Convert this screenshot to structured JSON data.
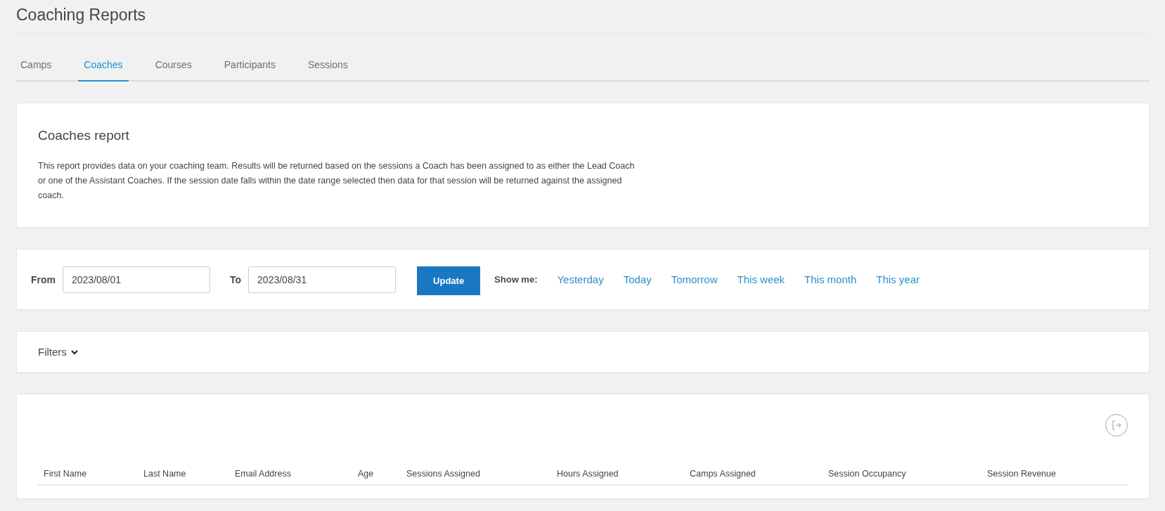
{
  "page_title": "Coaching Reports",
  "tabs": [
    {
      "label": "Camps",
      "selected": false
    },
    {
      "label": "Coaches",
      "selected": true
    },
    {
      "label": "Courses",
      "selected": false
    },
    {
      "label": "Participants",
      "selected": false
    },
    {
      "label": "Sessions",
      "selected": false
    }
  ],
  "intro": {
    "title": "Coaches report",
    "text": "This report provides data on your coaching team. Results will be returned based on the sessions a Coach has been assigned to as either the Lead Coach or one of the Assistant Coaches. If the session date falls within the date range selected then data for that session will be returned against the assigned coach."
  },
  "date_range": {
    "from_label": "From",
    "from_value": "2023/08/01",
    "to_label": "To",
    "to_value": "2023/08/31",
    "button": "Update",
    "show_me_label": "Show me:",
    "quick_links": [
      "Yesterday",
      "Today",
      "Tomorrow",
      "This week",
      "This month",
      "This year"
    ]
  },
  "filters": {
    "label": "Filters",
    "expanded": false
  },
  "table": {
    "columns": [
      "First Name",
      "Last Name",
      "Email Address",
      "Age",
      "Sessions Assigned",
      "Hours Assigned",
      "Camps Assigned",
      "Session Occupancy",
      "Session Revenue"
    ]
  }
}
